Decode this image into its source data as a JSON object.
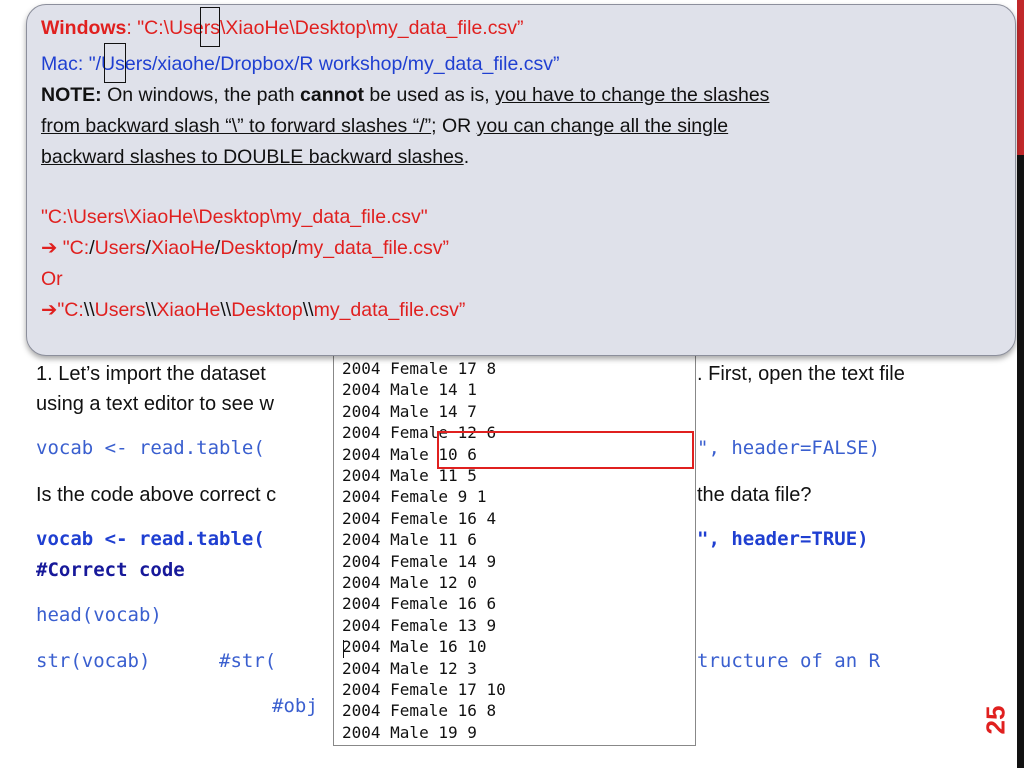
{
  "slide": {
    "page_number": "25",
    "para1_part1": "1. Let’s import the dataset",
    "para1_part2": ". First, open the text file",
    "para1_line2": "using a text editor to see w",
    "code1_left": "vocab <- read.table(",
    "code1_right": "\", header=FALSE)",
    "question_left": "Is the code above correct c",
    "question_right": "the data file?",
    "code2_left": "vocab <- read.table(",
    "code2_right": "\", header=TRUE)",
    "code2_comment": "#Correct code",
    "code3": "head(vocab)",
    "code4_left": "str(vocab)      #str(",
    "code4_right": "tructure of an R",
    "code5": "#obj"
  },
  "file_window": {
    "lines": [
      "2004 Female 17 8",
      "2004 Male 14 1",
      "2004 Male 14 7",
      "2004 Female 12 6",
      "2004 Male 10 6",
      "2004 Male 11 5",
      "2004 Female 9 1",
      "2004 Female 16 4",
      "2004 Male 11 6",
      "2004 Female 14 9",
      "2004 Male 12 0",
      "2004 Female 16 6",
      "2004 Female 13 9",
      "2004 Male 16 10",
      "2004 Male 12 3",
      "2004 Female 17 10",
      "2004 Female 16 8",
      "2004 Male 19 9"
    ]
  },
  "note": {
    "windows_label": "Windows",
    "windows_path": ": \"C:\\Users\\XiaoHe\\Desktop\\my_data_file.csv”",
    "mac_label": "Mac: ",
    "mac_path": "\"/Users/xiaohe/Dropbox/R workshop/my_data_file.csv”",
    "note_label": "NOTE:",
    "note_text1": " On windows, the path ",
    "note_cannot": "cannot",
    "note_text2": " be used as is, ",
    "note_ul1": "you have to change the slashes",
    "note_ul2": "from backward slash “\\” to forward slashes “/”",
    "note_text3": "; OR ",
    "note_ul3": "you can change all the single",
    "note_ul4": "backward slashes to DOUBLE backward slashes",
    "note_period": ".",
    "example_original": "\"C:\\Users\\XiaoHe\\Desktop\\my_data_file.csv\"",
    "ex1_arrow": "➔",
    "ex1_a": " \"C:",
    "ex1_s1": "/",
    "ex1_b": "Users",
    "ex1_s2": "/",
    "ex1_c": "XiaoHe",
    "ex1_s3": "/",
    "ex1_d": "Desktop",
    "ex1_s4": "/",
    "ex1_e": "my_data_file.csv”",
    "or_text": "Or",
    "ex2_arrow": "➔",
    "ex2_a": "\"C:",
    "ex2_s1": "\\\\",
    "ex2_b": "Users",
    "ex2_s2": "\\\\",
    "ex2_c": "XiaoHe",
    "ex2_s3": "\\\\",
    "ex2_d": "Desktop",
    "ex2_s4": "\\\\",
    "ex2_e": "my_data_file.csv”"
  },
  "colors": {
    "accent_red": "#c0282a",
    "label_red": "#e0201f",
    "code_blue": "#3a5fcf",
    "note_bg": "#dfe1ea"
  }
}
